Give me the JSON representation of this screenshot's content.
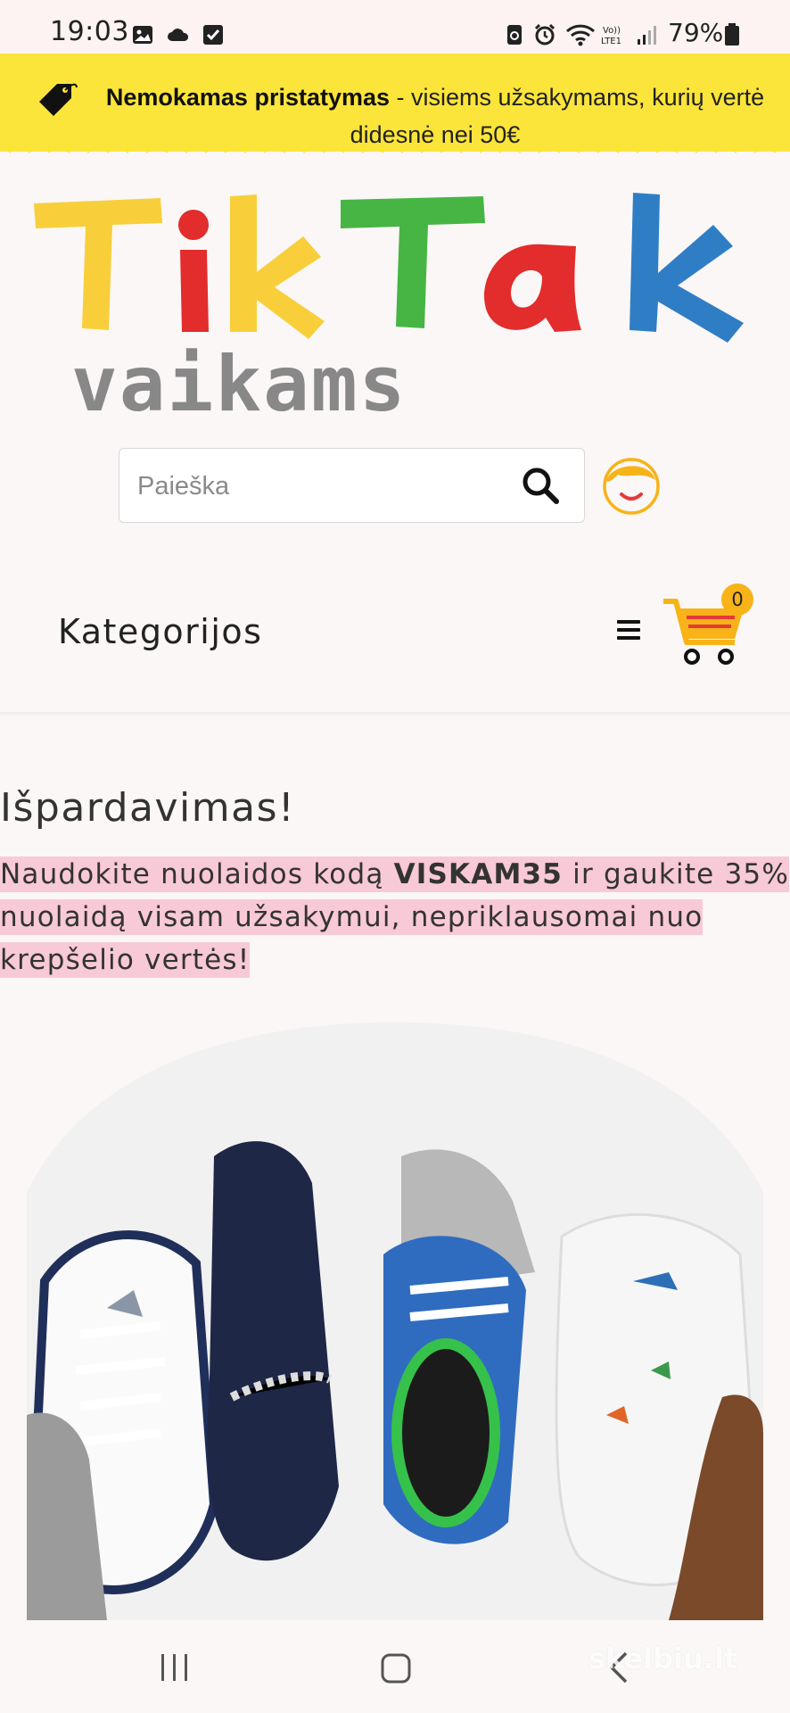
{
  "status_bar": {
    "time": "19:03",
    "battery_percent": "79%",
    "icons": [
      "image-icon",
      "cloud-icon",
      "checkbox-icon",
      "recycle-icon",
      "alarm-icon",
      "wifi-icon",
      "volte-icon",
      "signal-icon",
      "battery-icon"
    ]
  },
  "promo": {
    "icon": "price-tag-icon",
    "bold_text": "Nemokamas pristatymas",
    "rest_text": " - visiems užsakymams, kurių vertė didesnė nei 50€",
    "color": "#fce53a"
  },
  "logo": {
    "word_letters": [
      "T",
      "i",
      "k",
      "T",
      "a",
      "k"
    ],
    "letter_colors": [
      "#f8cf3a",
      "#e32c2c",
      "#f8cf3a",
      "#46b544",
      "#e32c2c",
      "#2f7ec5"
    ],
    "subtitle": "vaikams"
  },
  "search": {
    "placeholder": "Paieška",
    "value": ""
  },
  "nav": {
    "categories_label": "Kategorijos",
    "cart_count": "0"
  },
  "sale": {
    "title": "Išpardavimas!",
    "text_before": "Naudokite nuolaidos kodą ",
    "code": "VISKAM35",
    "text_after": " ir gaukite 35% nuolaidą visam užsakymui, nepriklausomai nuo krepšelio vertės!",
    "highlight_color": "#f8c9d6"
  },
  "bottom_nav": {
    "items": [
      "recent-apps-icon",
      "home-icon",
      "back-icon"
    ]
  },
  "watermark": "skelbiu.lt"
}
